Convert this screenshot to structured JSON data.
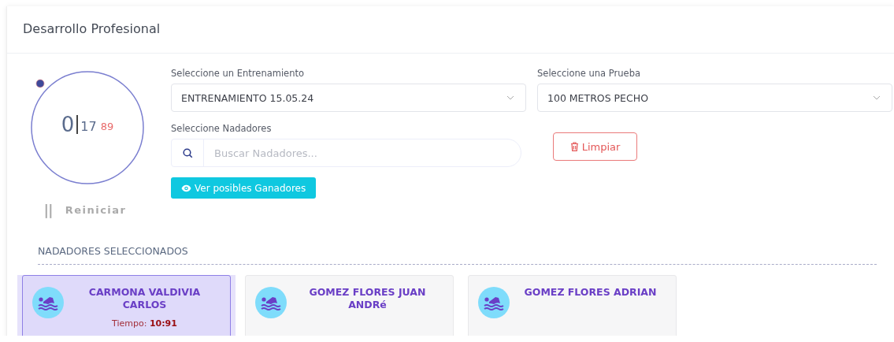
{
  "header": {
    "title": "Desarrollo Profesional"
  },
  "timer": {
    "minutes": "0",
    "seconds": "17",
    "hundredths": "89",
    "pause_label": "||",
    "reset_label": "Reiniciar"
  },
  "form": {
    "training": {
      "label": "Seleccione un Entrenamiento",
      "value": "ENTRENAMIENTO 15.05.24"
    },
    "event": {
      "label": "Seleccione una Prueba",
      "value": "100 METROS PECHO"
    },
    "swimmers": {
      "label": "Seleccione Nadadores",
      "placeholder": "Buscar Nadadores..."
    },
    "clear_button": "Limpiar",
    "winners_button": "Ver posibles Ganadores"
  },
  "selected_section": {
    "title": "NADADORES SELECCIONADOS",
    "swimmers": [
      {
        "name": "CARMONA VALDIVIA CARLOS",
        "selected": true,
        "time_label": "Tiempo:",
        "time": "10:91"
      },
      {
        "name": "GOMEZ FLORES JUAN ANDRé",
        "selected": false
      },
      {
        "name": "GOMEZ FLORES ADRIAN",
        "selected": false
      }
    ]
  }
}
